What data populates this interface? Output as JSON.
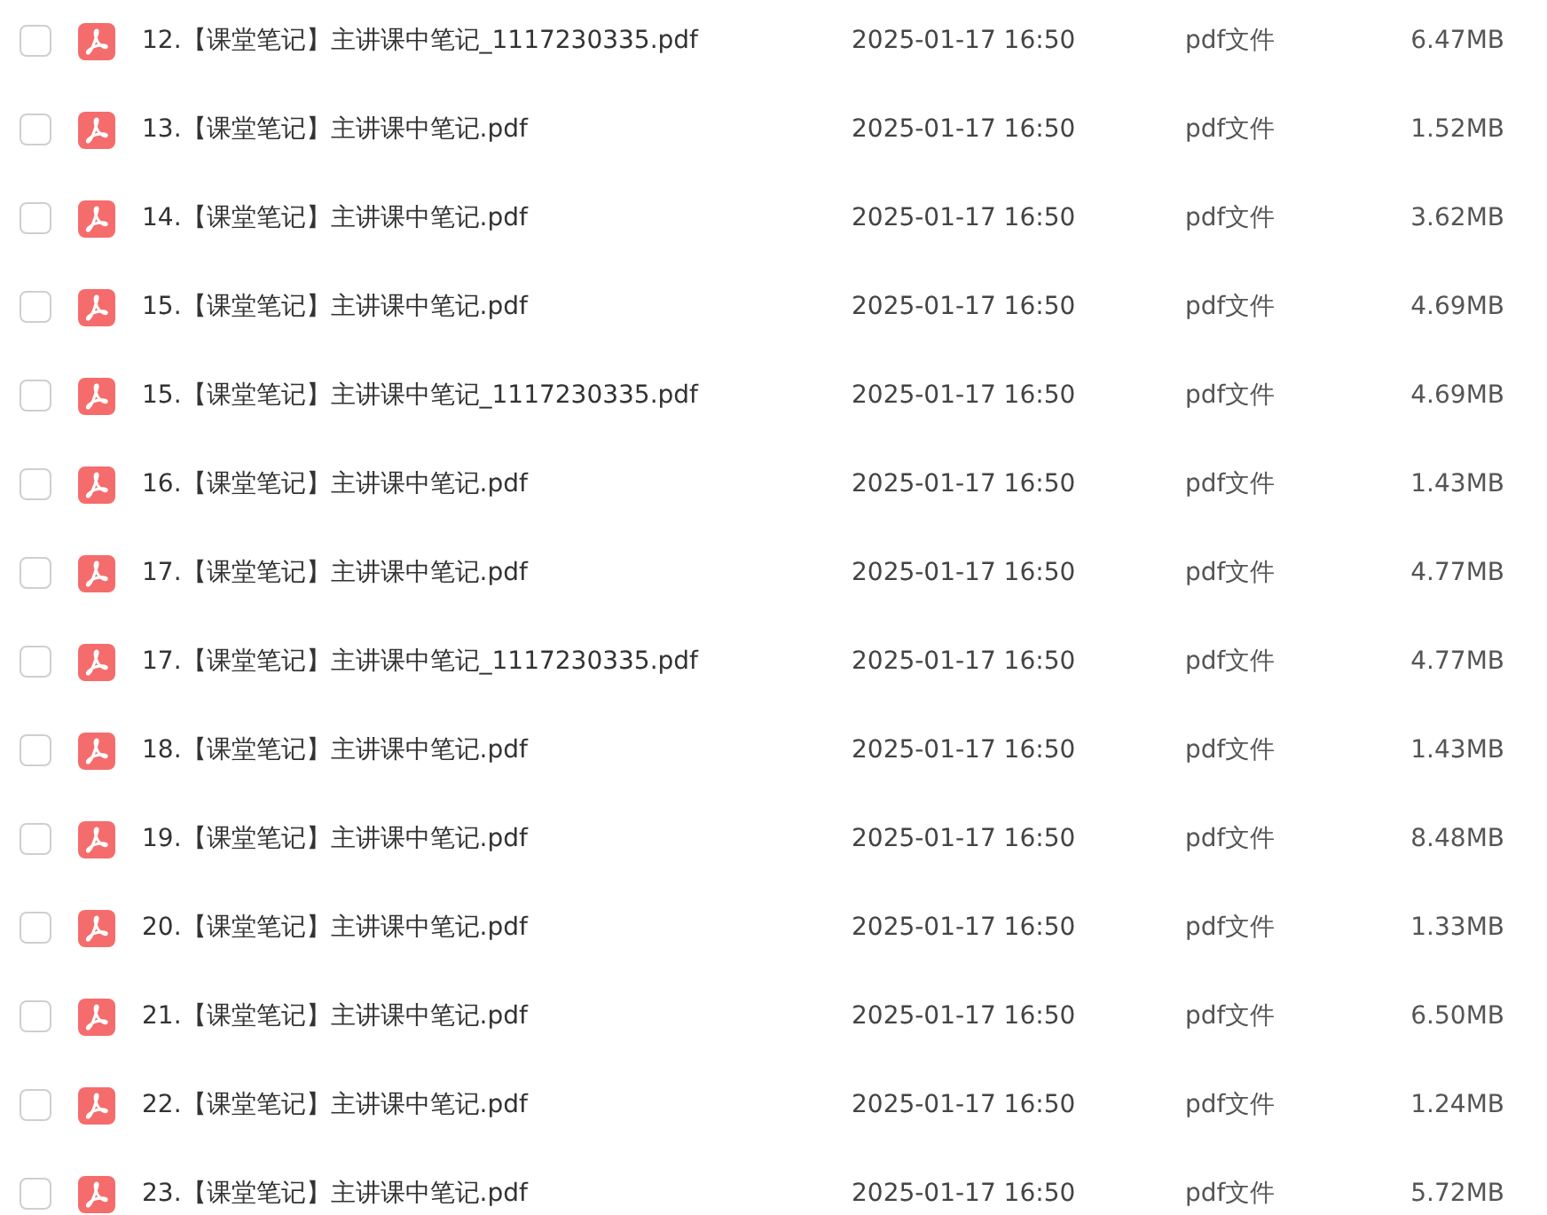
{
  "files": [
    {
      "name": "12.【课堂笔记】主讲课中笔记_1117230335.pdf",
      "date": "2025-01-17 16:50",
      "type": "pdf文件",
      "size": "6.47MB",
      "checked": false
    },
    {
      "name": "13.【课堂笔记】主讲课中笔记.pdf",
      "date": "2025-01-17 16:50",
      "type": "pdf文件",
      "size": "1.52MB",
      "checked": false
    },
    {
      "name": "14.【课堂笔记】主讲课中笔记.pdf",
      "date": "2025-01-17 16:50",
      "type": "pdf文件",
      "size": "3.62MB",
      "checked": false
    },
    {
      "name": "15.【课堂笔记】主讲课中笔记.pdf",
      "date": "2025-01-17 16:50",
      "type": "pdf文件",
      "size": "4.69MB",
      "checked": false
    },
    {
      "name": "15.【课堂笔记】主讲课中笔记_1117230335.pdf",
      "date": "2025-01-17 16:50",
      "type": "pdf文件",
      "size": "4.69MB",
      "checked": false
    },
    {
      "name": "16.【课堂笔记】主讲课中笔记.pdf",
      "date": "2025-01-17 16:50",
      "type": "pdf文件",
      "size": "1.43MB",
      "checked": false
    },
    {
      "name": "17.【课堂笔记】主讲课中笔记.pdf",
      "date": "2025-01-17 16:50",
      "type": "pdf文件",
      "size": "4.77MB",
      "checked": false
    },
    {
      "name": "17.【课堂笔记】主讲课中笔记_1117230335.pdf",
      "date": "2025-01-17 16:50",
      "type": "pdf文件",
      "size": "4.77MB",
      "checked": false
    },
    {
      "name": "18.【课堂笔记】主讲课中笔记.pdf",
      "date": "2025-01-17 16:50",
      "type": "pdf文件",
      "size": "1.43MB",
      "checked": false
    },
    {
      "name": "19.【课堂笔记】主讲课中笔记.pdf",
      "date": "2025-01-17 16:50",
      "type": "pdf文件",
      "size": "8.48MB",
      "checked": false
    },
    {
      "name": "20.【课堂笔记】主讲课中笔记.pdf",
      "date": "2025-01-17 16:50",
      "type": "pdf文件",
      "size": "1.33MB",
      "checked": false
    },
    {
      "name": "21.【课堂笔记】主讲课中笔记.pdf",
      "date": "2025-01-17 16:50",
      "type": "pdf文件",
      "size": "6.50MB",
      "checked": false
    },
    {
      "name": "22.【课堂笔记】主讲课中笔记.pdf",
      "date": "2025-01-17 16:50",
      "type": "pdf文件",
      "size": "1.24MB",
      "checked": false
    },
    {
      "name": "23.【课堂笔记】主讲课中笔记.pdf",
      "date": "2025-01-17 16:50",
      "type": "pdf文件",
      "size": "5.72MB",
      "checked": false
    }
  ]
}
